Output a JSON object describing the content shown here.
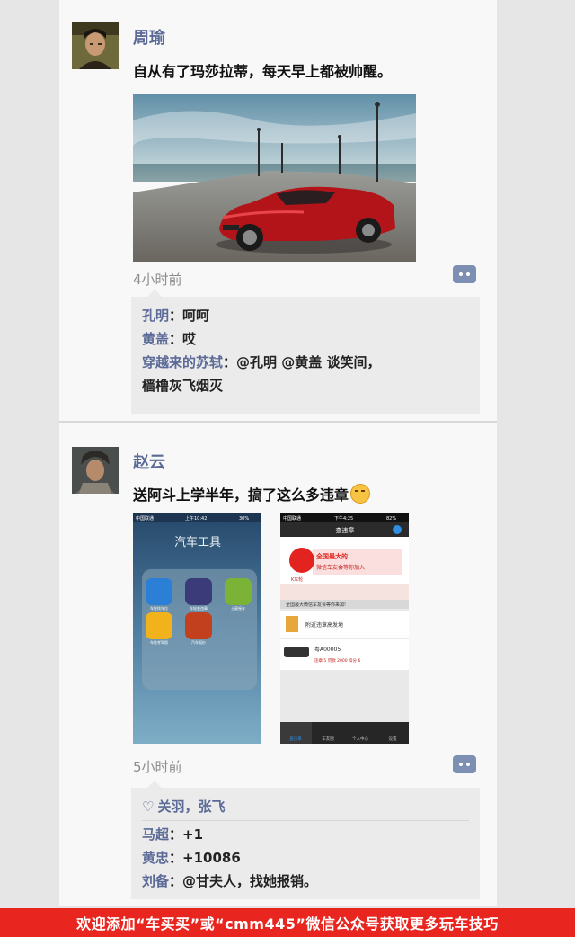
{
  "posts": [
    {
      "author": "周瑜",
      "text": "自从有了玛莎拉蒂，每天早上都被帅醒。",
      "time": "4小时前",
      "comments": [
        {
          "name": "孔明",
          "text": "：呵呵"
        },
        {
          "name": "黄盖",
          "text": "：哎"
        },
        {
          "name": "穿越来的苏轼",
          "text": "：@孔明 @黄盖  谈笑间，"
        }
      ],
      "comment_cont": "樯橹灰飞烟灭"
    },
    {
      "author": "赵云",
      "text": "送阿斗上学半年，搞了这么多违章",
      "time": "5小时前",
      "likes": "关羽，张飞",
      "comments": [
        {
          "name": "马超",
          "text": "：+1"
        },
        {
          "name": "黄忠",
          "text": "：+10086"
        },
        {
          "name": "刘备",
          "text": "：@甘夫人，找她报销。"
        }
      ]
    }
  ],
  "phone1": {
    "carrier": "中国联通",
    "clock": "上午10:42",
    "battery": "30%",
    "folder_title": "汽车工具",
    "apps": [
      "车轮找车位",
      "车轮查违章",
      "土豪摇车",
      "车轮考驾照",
      "汽车报价"
    ]
  },
  "phone2": {
    "carrier": "中国联通",
    "clock": "下午4:25",
    "battery": "82%",
    "title": "查违章",
    "ad_line1": "全国最大的",
    "ad_line2": "微信车友会等你加入",
    "brand": "K车轮",
    "notice": "全国最大微信车友会等你来加!",
    "nearby": "附近违章高发地",
    "plate": "粤A00005",
    "stats": "违章 5  罚款 2000  扣分 6",
    "tabs": [
      "查违章",
      "车友圈",
      "个人中心",
      "设置"
    ]
  },
  "banner": "欢迎添加“车买买”或“cmm445”微信公众号获取更多玩车技巧"
}
